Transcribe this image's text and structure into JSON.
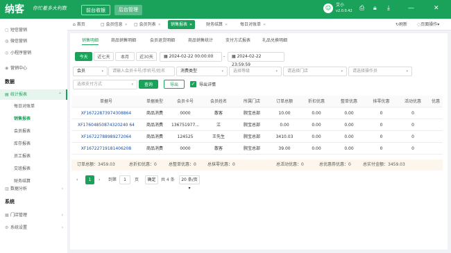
{
  "brand": {
    "logo": "纳客",
    "slogan": "你忙着多大利数"
  },
  "topnav": {
    "front": "前台收银",
    "back": "后台管理"
  },
  "user": {
    "name": "艾小",
    "version": "v2.0.0.42"
  },
  "topbar_icons": [
    "printer-icon",
    "download-icon",
    "lock-icon",
    "minimize-icon",
    "close-icon"
  ],
  "sidebar": {
    "items": [
      {
        "label": "短信营销",
        "icon": "message-icon"
      },
      {
        "label": "微信营销",
        "icon": "wechat-icon"
      },
      {
        "label": "小程序营销",
        "icon": "miniprogram-icon"
      },
      {
        "label": "营销中心",
        "icon": "target-icon"
      }
    ],
    "data_section": "数据",
    "stats": {
      "label": "统计报表",
      "icon": "chart-icon"
    },
    "subitems": [
      "每日对账单",
      "销售报表",
      "会员报表",
      "库存报表",
      "员工报表",
      "交班报表",
      "财务结算"
    ],
    "analysis": {
      "label": "数据分析",
      "icon": "analysis-icon"
    },
    "system_section": "系统",
    "store": {
      "label": "门店管理",
      "icon": "store-icon"
    },
    "settings": {
      "label": "系统设置",
      "icon": "settings-icon"
    }
  },
  "tabs": [
    {
      "label": "首页",
      "closable": false
    },
    {
      "label": "会员信息",
      "closable": true
    },
    {
      "label": "会员列表",
      "closable": true
    },
    {
      "label": "销售报表",
      "closable": true,
      "active": true
    },
    {
      "label": "财务结算",
      "closable": true
    },
    {
      "label": "每日对账单",
      "closable": true
    }
  ],
  "tab_tools": {
    "refresh": "刷新",
    "page_ops": "页面操作"
  },
  "subtabs": [
    "销售明细",
    "商品销售明细",
    "会员退货明细",
    "商品销售统计",
    "支付方式报表",
    "礼品兑换明细"
  ],
  "filters": {
    "quick": [
      "今天",
      "近七天",
      "本月",
      "近30天"
    ],
    "date_start": "2024-02-22 00:00:00",
    "date_sep": "-",
    "date_end": "2024-02-22 23:59:59",
    "member_type": "会员",
    "member_placeholder": "请输入会员卡号/手机号/姓名",
    "consume_type": "消费类型",
    "level_placeholder": "选择等级",
    "store_placeholder": "请选择门店",
    "operator_placeholder": "请选择操作员",
    "payment_placeholder": "选择支付方式",
    "query": "查询",
    "export": "导出",
    "export_detail": "导出详情"
  },
  "table": {
    "headers": [
      "单据号",
      "单据类型",
      "会员卡号",
      "会员姓名",
      "所属门店",
      "订单总额",
      "折扣优惠",
      "整单优惠",
      "抹零优惠",
      "活动优惠",
      "优惠"
    ],
    "rows": [
      [
        "XF16722873974308864",
        "商品消费",
        "0000",
        "散客",
        "腕宝总部",
        "10.00",
        "0.00",
        "0.00",
        "0",
        "0",
        ""
      ],
      [
        "XF17604850874320240 64",
        "商品消费",
        "136751977...",
        "江",
        "腕宝总部",
        "0.00",
        "0.00",
        "0.00",
        "0",
        "0",
        ""
      ],
      [
        "XF16722788989272064",
        "商品消费",
        "124525",
        "王先生",
        "腕宝总部",
        "3410.03",
        "0.00",
        "0.00",
        "0",
        "0",
        ""
      ],
      [
        "XF16722719181406208",
        "商品消费",
        "0000",
        "散客",
        "腕宝总部",
        "39.00",
        "0.00",
        "0.00",
        "0",
        "0",
        ""
      ]
    ]
  },
  "summary": {
    "total": "订单总额：3459.03",
    "discount": "总折扣优惠：0",
    "whole": "总整单优惠：0",
    "round": "总抹零优惠：0",
    "activity": "总活动优惠：0",
    "coupon": "总优惠券优惠：0",
    "paid": "总实付金额：3459.03"
  },
  "pager": {
    "current": "1",
    "goto_label": "到第",
    "page_input": "1",
    "page_unit": "页",
    "confirm": "确定",
    "total": "共 4 条",
    "page_size": "20 条/页"
  }
}
